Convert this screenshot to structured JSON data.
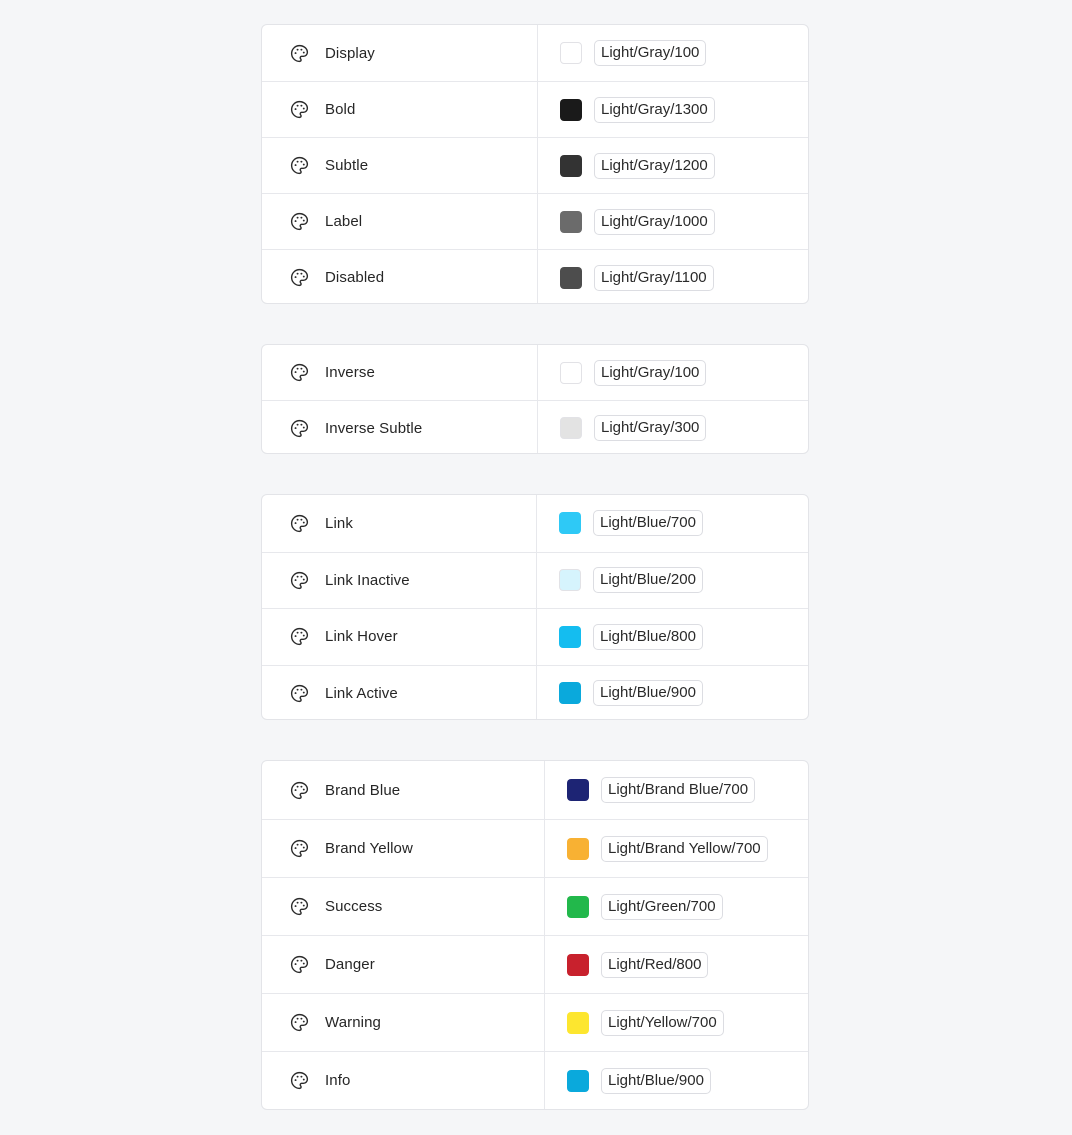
{
  "groups": [
    {
      "rows": [
        {
          "label": "Display",
          "token": "Light/Gray/100",
          "color": "#ffffff",
          "light": true
        },
        {
          "label": "Bold",
          "token": "Light/Gray/1300",
          "color": "#1a1a1a",
          "light": false
        },
        {
          "label": "Subtle",
          "token": "Light/Gray/1200",
          "color": "#333333",
          "light": false
        },
        {
          "label": "Label",
          "token": "Light/Gray/1000",
          "color": "#6b6b6b",
          "light": false
        },
        {
          "label": "Disabled",
          "token": "Light/Gray/1100",
          "color": "#4d4d4d",
          "light": false
        }
      ]
    },
    {
      "rows": [
        {
          "label": "Inverse",
          "token": "Light/Gray/100",
          "color": "#ffffff",
          "light": true
        },
        {
          "label": "Inverse Subtle",
          "token": "Light/Gray/300",
          "color": "#e3e3e3",
          "light": true
        }
      ]
    },
    {
      "rows": [
        {
          "label": "Link",
          "token": "Light/Blue/700",
          "color": "#2ec9f6",
          "light": false
        },
        {
          "label": "Link Inactive",
          "token": "Light/Blue/200",
          "color": "#d6f4fd",
          "light": true
        },
        {
          "label": "Link Hover",
          "token": "Light/Blue/800",
          "color": "#14bdf0",
          "light": false
        },
        {
          "label": "Link Active",
          "token": "Light/Blue/900",
          "color": "#0aa9dc",
          "light": false
        }
      ]
    },
    {
      "rows": [
        {
          "label": "Brand Blue",
          "token": "Light/Brand Blue/700",
          "color": "#1d2474",
          "light": false
        },
        {
          "label": "Brand Yellow",
          "token": "Light/Brand Yellow/700",
          "color": "#f8b133",
          "light": false
        },
        {
          "label": "Success",
          "token": "Light/Green/700",
          "color": "#22b84b",
          "light": false
        },
        {
          "label": "Danger",
          "token": "Light/Red/800",
          "color": "#c8212d",
          "light": false
        },
        {
          "label": "Warning",
          "token": "Light/Yellow/700",
          "color": "#fde62f",
          "light": false
        },
        {
          "label": "Info",
          "token": "Light/Blue/900",
          "color": "#0aa9dc",
          "light": false
        }
      ]
    }
  ],
  "icon": "palette-icon"
}
